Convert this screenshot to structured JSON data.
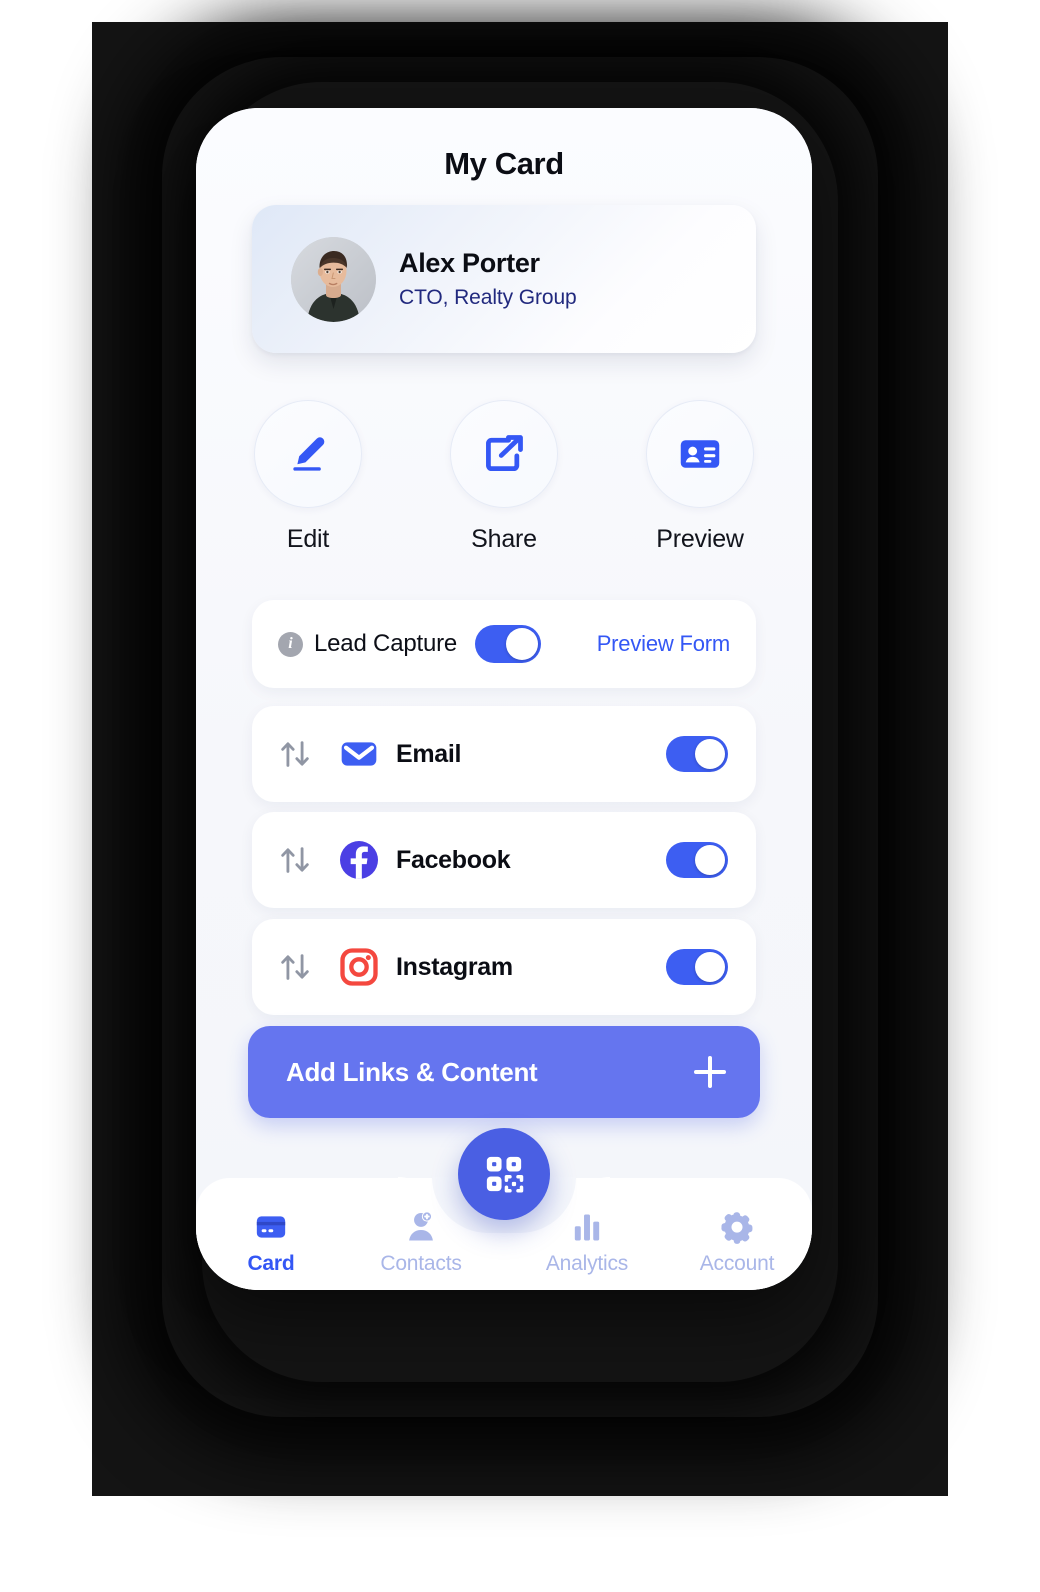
{
  "theme": {
    "primary_blue": "#3d5ef2",
    "button_blue": "#6575ef",
    "fab_blue": "#4a5fe3",
    "link_blue": "#3457f5",
    "role_navy": "#21297e",
    "muted_nav": "#a9b6e8",
    "backdrop": "#141414"
  },
  "header": {
    "title": "My Card"
  },
  "profile": {
    "name": "Alex Porter",
    "role": "CTO, Realty Group",
    "avatar_icon": "user-photo"
  },
  "actions": [
    {
      "label": "Edit",
      "icon": "pencil-icon"
    },
    {
      "label": "Share",
      "icon": "share-icon"
    },
    {
      "label": "Preview",
      "icon": "id-card-icon"
    }
  ],
  "lead_capture": {
    "info_icon": "info-icon",
    "info_glyph": "i",
    "label": "Lead Capture",
    "enabled": true,
    "preview_link": "Preview Form"
  },
  "links": [
    {
      "label": "Email",
      "icon": "email-icon",
      "enabled": true,
      "reorder_icon": "reorder-arrows-icon"
    },
    {
      "label": "Facebook",
      "icon": "facebook-icon",
      "enabled": true,
      "reorder_icon": "reorder-arrows-icon"
    },
    {
      "label": "Instagram",
      "icon": "instagram-icon",
      "enabled": true,
      "reorder_icon": "reorder-arrows-icon"
    }
  ],
  "add_button": {
    "label": "Add Links & Content",
    "icon": "plus-icon"
  },
  "fab": {
    "icon": "qr-code-icon"
  },
  "bottom_nav": {
    "items": [
      {
        "label": "Card",
        "icon": "credit-card-icon",
        "active": true
      },
      {
        "label": "Contacts",
        "icon": "add-person-icon",
        "active": false
      },
      {
        "label": "Analytics",
        "icon": "bar-chart-icon",
        "active": false
      },
      {
        "label": "Account",
        "icon": "gear-icon",
        "active": false
      }
    ]
  }
}
